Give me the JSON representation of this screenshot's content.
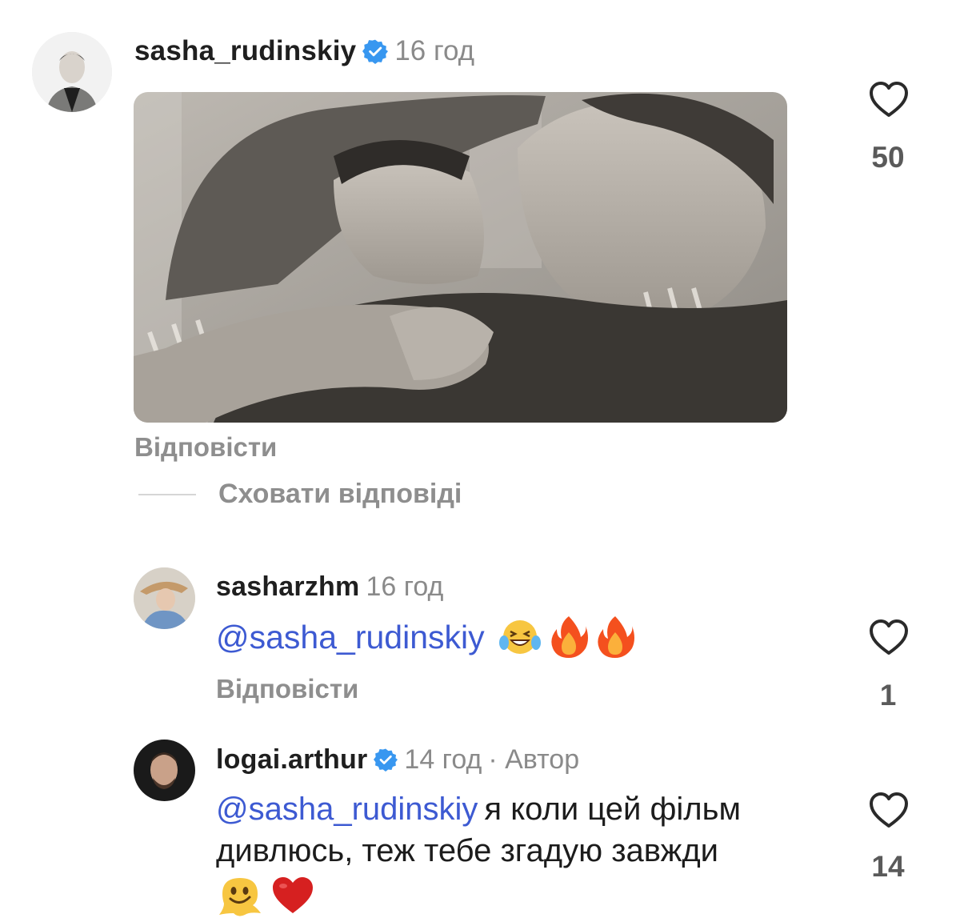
{
  "comment": {
    "username": "sasha_rudinskiy",
    "time": "16 год",
    "likes": "50",
    "reply_label": "Відповісти",
    "hide_replies_label": "Сховати відповіді"
  },
  "replies": [
    {
      "username": "sasharzhm",
      "time": "16 год",
      "mention": "@sasha_rudinskiy",
      "text": "",
      "emojis": [
        "laughing-tears",
        "fire",
        "fire"
      ],
      "likes": "1",
      "reply_label": "Відповісти"
    },
    {
      "username": "logai.arthur",
      "time": "14 год",
      "author_tag": "· Автор",
      "mention": "@sasha_rudinskiy",
      "text_line1": "я коли цей фільм",
      "text_line2": "дивлюсь, теж тебе згадую завжди",
      "emojis": [
        "melting-face",
        "red-heart"
      ],
      "likes": "14"
    }
  ],
  "colors": {
    "mention": "#3d5ad2",
    "verified": "#3897f0",
    "muted": "#8a8a8a"
  }
}
